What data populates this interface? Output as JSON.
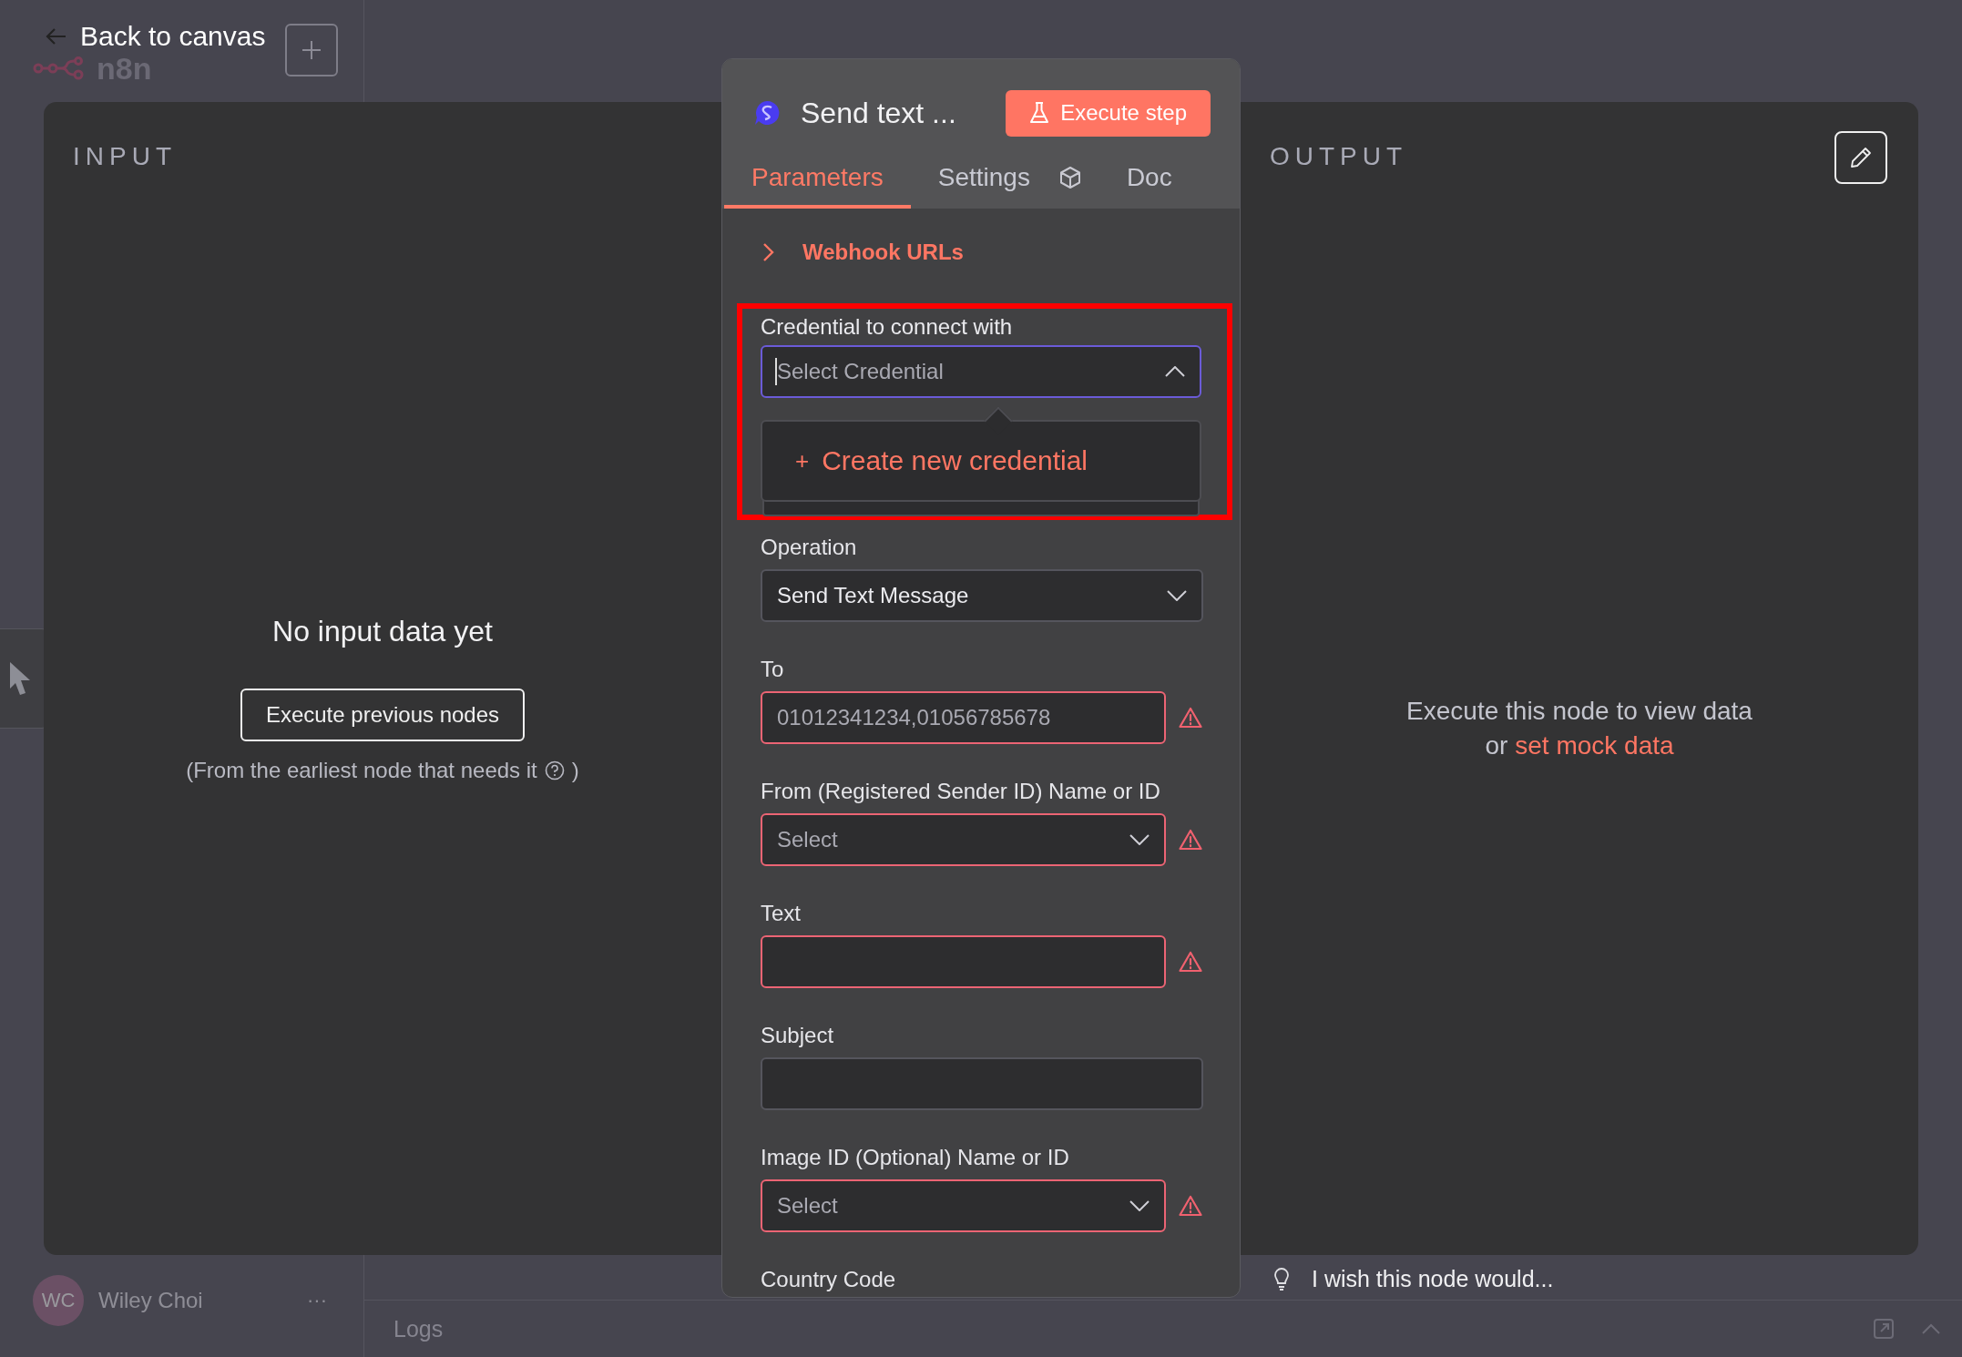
{
  "sidebar": {
    "logo": "n8n",
    "user": {
      "initials": "WC",
      "name": "Wiley Choi",
      "more": "···"
    }
  },
  "back_link": "Back to canvas",
  "input_panel": {
    "title": "INPUT",
    "message": "No input data yet",
    "button": "Execute previous nodes",
    "hint": "(From the earliest node that needs it",
    "hint_end": ")"
  },
  "output_panel": {
    "title": "OUTPUT",
    "message": "Execute this node to view data",
    "prefix": "or",
    "link": "set mock data"
  },
  "node": {
    "title": "Send text ...",
    "execute": "Execute step",
    "tabs": [
      {
        "label": "Parameters",
        "selected": true,
        "kind": "text"
      },
      {
        "label": "Settings",
        "selected": false,
        "kind": "text"
      },
      {
        "selected": false,
        "kind": "icon"
      },
      {
        "label": "Doc",
        "selected": false,
        "kind": "text"
      }
    ],
    "webhook": {
      "label": "Webhook URLs",
      "expanded": false
    },
    "credential": {
      "label": "Credential to connect with",
      "placeholder": "Select Credential",
      "open": true,
      "action_icon": "+",
      "action": "Create new credential"
    },
    "fields": [
      {
        "kind": "select",
        "label": "Operation",
        "value": "Send Text Message",
        "error": false
      },
      {
        "kind": "input",
        "label": "To",
        "placeholder": "01012341234,01056785678",
        "error": true
      },
      {
        "kind": "select",
        "label": "From (Registered Sender ID) Name or ID",
        "placeholder": "Select",
        "error": true
      },
      {
        "kind": "input",
        "label": "Text",
        "error": true
      },
      {
        "kind": "input",
        "label": "Subject",
        "error": false
      },
      {
        "kind": "select",
        "label": "Image ID (Optional) Name or ID",
        "placeholder": "Select",
        "error": true
      },
      {
        "kind": "heading",
        "label": "Country Code"
      }
    ]
  },
  "feedback": "I wish this node would...",
  "logs": {
    "title": "Logs"
  }
}
